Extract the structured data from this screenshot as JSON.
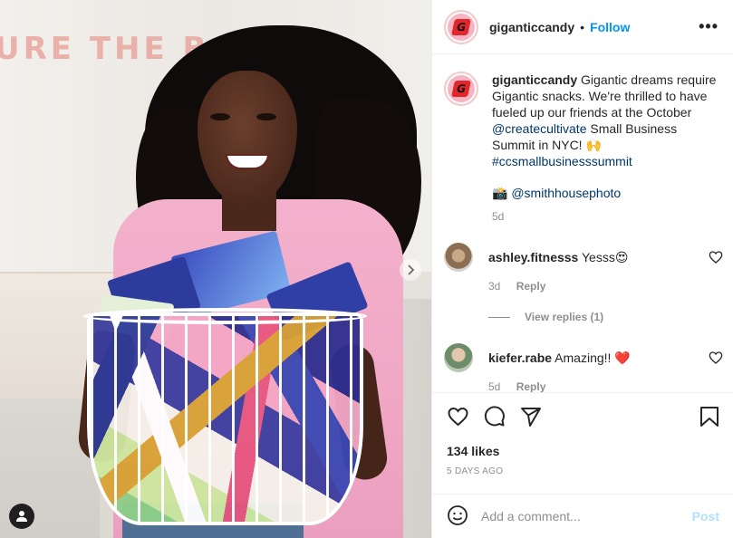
{
  "post": {
    "username": "giganticcandy",
    "dot": "•",
    "follow_label": "Follow",
    "more_label": "•••",
    "background_sign_text": "URE THE BA",
    "caption": {
      "username": "giganticcandy",
      "text_1": " Gigantic dreams require Gigantic snacks. We're thrilled to have fueled up our friends at the October ",
      "mention": "@createcultivate",
      "text_2": " Small Business Summit in NYC! 🙌",
      "hashtag": "#ccsmallbusinesssummit",
      "photo_credit_emoji": "📸",
      "photo_credit": "@smithhousephoto",
      "age": "5d"
    },
    "comments": [
      {
        "username": "ashley.fitnesss",
        "text": " Yesss😍",
        "age": "3d",
        "reply_label": "Reply",
        "view_replies": "View replies (1)"
      },
      {
        "username": "kiefer.rabe",
        "text": " Amazing!! ❤️",
        "age": "5d",
        "reply_label": "Reply"
      }
    ],
    "likes": "134 likes",
    "timestamp": "5 DAYS AGO",
    "comment_box": {
      "placeholder": "Add a comment...",
      "post_label": "Post"
    }
  },
  "colors": {
    "accent_blue": "#0095f6",
    "post_disabled": "#b2dffc",
    "muted": "#8e8e8e",
    "text": "#262626"
  },
  "icons": [
    "tag-user-icon",
    "next-arrow-icon",
    "more-icon",
    "heart-icon",
    "comment-icon",
    "share-icon",
    "bookmark-icon",
    "emoji-icon",
    "like-comment-heart-icon"
  ]
}
